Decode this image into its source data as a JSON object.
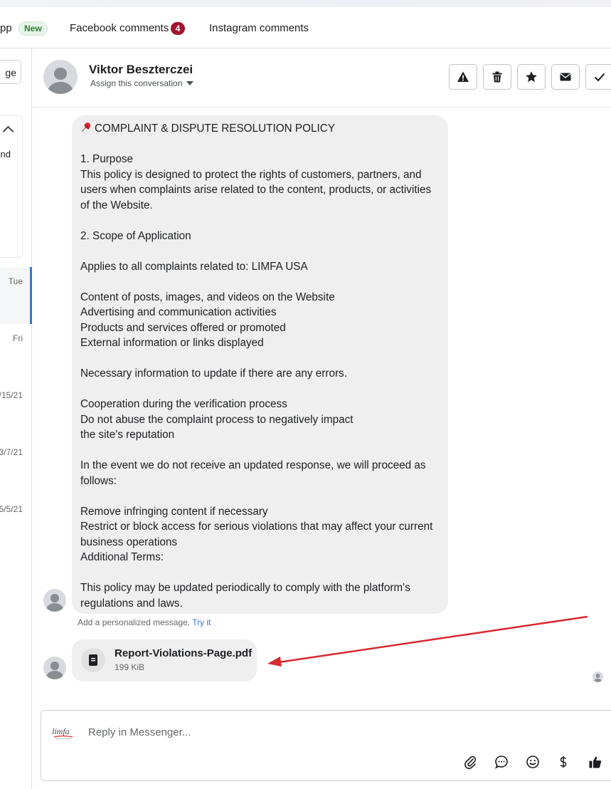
{
  "tabs": {
    "whatsapp_partial": "pp",
    "whatsapp_badge": "New",
    "facebook_label": "Facebook comments",
    "facebook_count": "4",
    "instagram_label": "Instagram comments"
  },
  "left_panel": {
    "button_partial": "ge",
    "card_text_partial": "nd",
    "dates": [
      "Tue",
      "Fri",
      "/15/21",
      "3/7/21",
      "5/5/21"
    ]
  },
  "conversation": {
    "name": "Viktor Beszterczei",
    "assign": "Assign this conversation",
    "actions": [
      "report-icon",
      "trash-icon",
      "star-icon",
      "mail-icon",
      "check-icon"
    ]
  },
  "message": {
    "title": "COMPLAINT & DISPUTE RESOLUTION POLICY",
    "body": "\n1. Purpose\nThis policy is designed to protect the rights of customers, partners, and users when complaints arise related to the content, products, or activities of the Website.\n\n2. Scope of Application\n\nApplies to all complaints related to: LIMFA USA\n\nContent of posts, images, and videos on the Website\nAdvertising and communication activities\nProducts and services offered or promoted\nExternal information or links displayed\n\nNecessary information to update if there are any errors.\n\nCooperation during the verification process\nDo not abuse the complaint process to negatively impact\nthe site's reputation\n\nIn the event we do not receive an updated response, we will proceed as follows:\n\nRemove infringing content if necessary\nRestrict or block access for serious violations that may affect your current business operations\nAdditional Terms:\n\nThis policy may be updated periodically to comply with the platform's regulations and laws.",
    "personalized_text": "Add a personalized message.",
    "try_it": "Try it"
  },
  "attachment": {
    "filename": "Report-Violations-Page.pdf",
    "size": "199 KiB"
  },
  "reply": {
    "placeholder": "Reply in Messenger...",
    "logo_text": "limfa",
    "tools": [
      "paperclip-icon",
      "chat-bubble-icon",
      "emoji-icon",
      "dollar-icon",
      "thumbs-up-icon"
    ]
  },
  "colors": {
    "accent": "#3b73d6",
    "count_badge": "#a4132d",
    "arrow": "#d9282f",
    "bubble": "#efefef"
  }
}
